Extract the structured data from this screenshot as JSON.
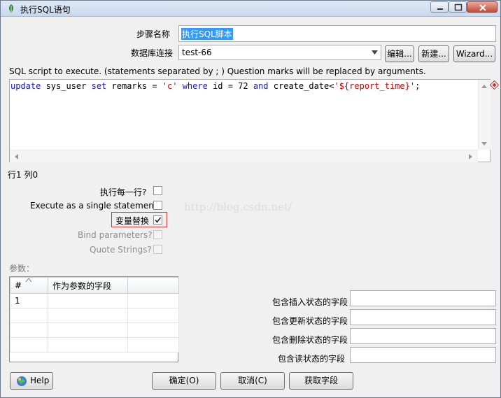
{
  "window": {
    "title": "执行SQL语句"
  },
  "step": {
    "label": "步骤名称",
    "value": "执行SQL脚本"
  },
  "connection": {
    "label": "数据库连接",
    "value": "test-66",
    "edit_button": "编辑...",
    "new_button": "新建...",
    "wizard_button": "Wizard..."
  },
  "sql": {
    "hint": "SQL script to execute. (statements separated by ; ) Question marks will be replaced by arguments.",
    "tokens": {
      "t1": "update",
      "t2": " sys_user ",
      "t3": "set",
      "t4": " remarks = ",
      "t5": "'c'",
      "t6": " ",
      "t7": "where",
      "t8": " id = 72 ",
      "t9": "and",
      "t10": " create_date<",
      "t11": "'${report_time}'",
      "t12": ";"
    },
    "position": "行1 列0"
  },
  "options": {
    "each_row": "执行每一行?",
    "single_statement": "Execute as a single statement",
    "variable_substitution": "变量替换",
    "bind_parameters": "Bind parameters?",
    "quote_strings": "Quote Strings?"
  },
  "parameters": {
    "label": "参数：",
    "columns": [
      "#",
      "作为参数的字段"
    ],
    "rows": [
      [
        "1",
        ""
      ]
    ]
  },
  "status_fields": {
    "insert": "包含插入状态的字段",
    "update": "包含更新状态的字段",
    "delete": "包含删除状态的字段",
    "read": "包含读状态的字段"
  },
  "buttons": {
    "help": "Help",
    "ok": "确定(O)",
    "cancel": "取消(C)",
    "get_fields": "获取字段"
  },
  "watermark": "http://blog.csdn.net/",
  "colors": {
    "selection": "#3399ff",
    "highlight_border": "#e03030",
    "keyword": "#1515d8",
    "string": "#cc0000"
  }
}
